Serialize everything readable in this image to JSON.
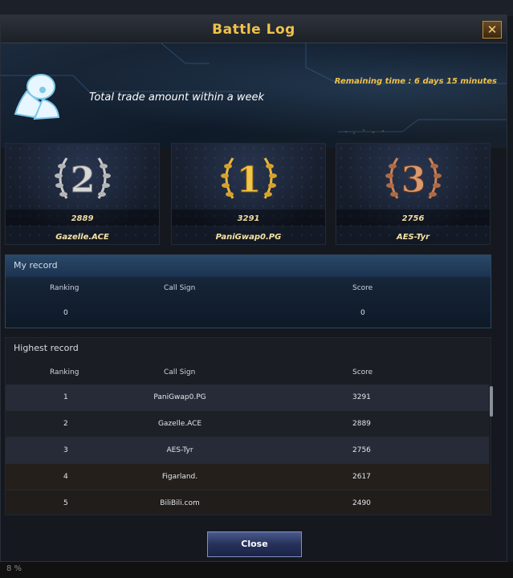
{
  "window": {
    "title": "Battle Log",
    "close_glyph": "✕"
  },
  "banner": {
    "remaining_time": "Remaining time : 6 days 15 minutes",
    "category": "Total trade amount within a week",
    "icon": "pilot-icon"
  },
  "podium": [
    {
      "rank": "2",
      "score": "2889",
      "name": "Gazelle.ACE",
      "medal": "silver",
      "color": "#c9c9c9"
    },
    {
      "rank": "1",
      "score": "3291",
      "name": "PaniGwap0.PG",
      "medal": "gold",
      "color": "#e8b83a"
    },
    {
      "rank": "3",
      "score": "2756",
      "name": "AES-Tyr",
      "medal": "bronze",
      "color": "#c8825a"
    }
  ],
  "my_record": {
    "title": "My record",
    "headers": {
      "ranking": "Ranking",
      "call_sign": "Call Sign",
      "score": "Score"
    },
    "row": {
      "ranking": "0",
      "call_sign": "",
      "score": "0"
    }
  },
  "highest_record": {
    "title": "Highest record",
    "headers": {
      "ranking": "Ranking",
      "call_sign": "Call Sign",
      "score": "Score"
    },
    "rows": [
      {
        "ranking": "1",
        "call_sign": "PaniGwap0.PG",
        "score": "3291"
      },
      {
        "ranking": "2",
        "call_sign": "Gazelle.ACE",
        "score": "2889"
      },
      {
        "ranking": "3",
        "call_sign": "AES-Tyr",
        "score": "2756"
      },
      {
        "ranking": "4",
        "call_sign": "Figarland.",
        "score": "2617"
      },
      {
        "ranking": "5",
        "call_sign": "BiliBili.com",
        "score": "2490"
      }
    ]
  },
  "close_button": "Close",
  "footer": {
    "percent": "8 %"
  }
}
